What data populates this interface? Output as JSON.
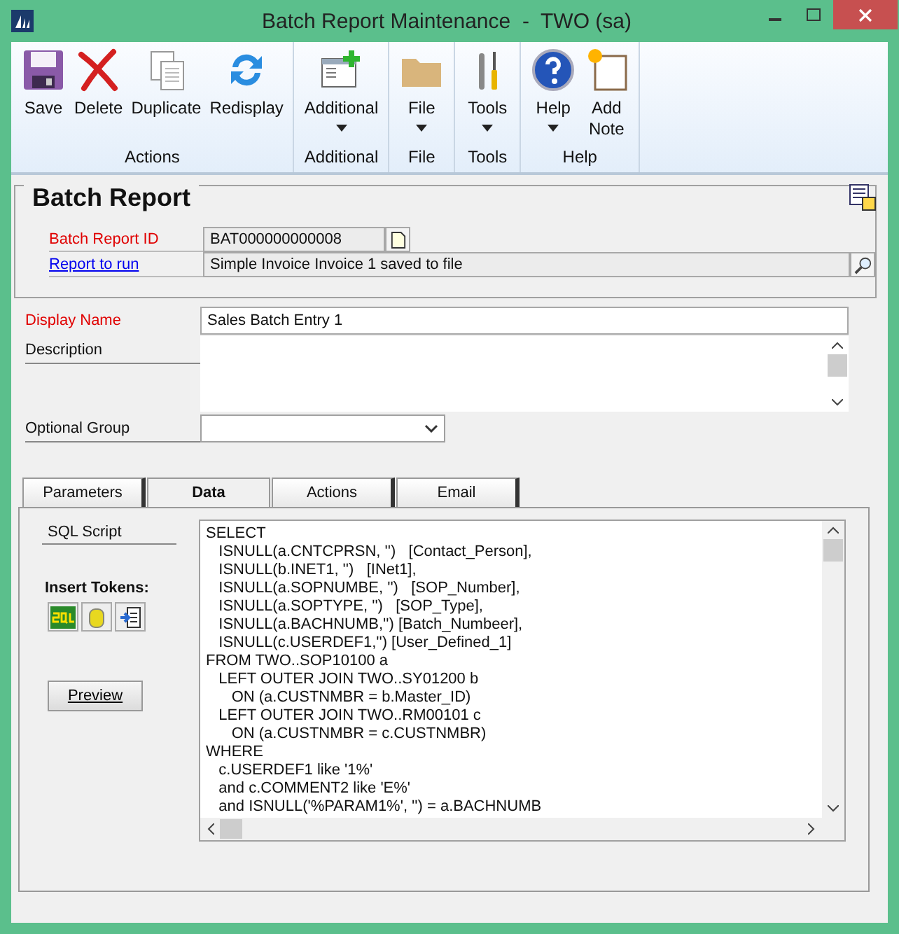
{
  "window": {
    "title": "Batch Report Maintenance  -  TWO (sa)"
  },
  "ribbon": {
    "groups": [
      {
        "label": "Actions",
        "buttons": [
          {
            "label": "Save",
            "dropdown": false
          },
          {
            "label": "Delete",
            "dropdown": false
          },
          {
            "label": "Duplicate",
            "dropdown": false
          },
          {
            "label": "Redisplay",
            "dropdown": false
          }
        ]
      },
      {
        "label": "Additional",
        "buttons": [
          {
            "label": "Additional",
            "dropdown": true
          }
        ]
      },
      {
        "label": "File",
        "buttons": [
          {
            "label": "File",
            "dropdown": true
          }
        ]
      },
      {
        "label": "Tools",
        "buttons": [
          {
            "label": "Tools",
            "dropdown": true
          }
        ]
      },
      {
        "label": "Help",
        "buttons": [
          {
            "label": "Help",
            "dropdown": true
          },
          {
            "label": "Add Note",
            "dropdown": false
          }
        ]
      }
    ]
  },
  "batch_report": {
    "title": "Batch Report",
    "id_label": "Batch Report ID",
    "id_value": "BAT000000000008",
    "report_label": "Report to run",
    "report_value": "Simple Invoice Invoice 1 saved to file"
  },
  "form": {
    "display_name_label": "Display Name",
    "display_name": "Sales Batch Entry 1",
    "description_label": "Description",
    "optional_group_label": "Optional Group"
  },
  "tabs": [
    {
      "label": "Parameters",
      "selected": false
    },
    {
      "label": "Data",
      "selected": true
    },
    {
      "label": "Actions",
      "selected": false
    },
    {
      "label": "Email",
      "selected": false
    }
  ],
  "data_tab": {
    "sql_label": "SQL Script",
    "insert_tokens": "Insert Tokens:",
    "preview": "Preview",
    "sql_lines": [
      "SELECT",
      "   ISNULL(a.CNTCPRSN, '')   [Contact_Person],",
      "   ISNULL(b.INET1, '')   [INet1],",
      "   ISNULL(a.SOPNUMBE, '')   [SOP_Number],",
      "   ISNULL(a.SOPTYPE, '')   [SOP_Type],",
      "   ISNULL(a.BACHNUMB,'') [Batch_Numbeer],",
      "   ISNULL(c.USERDEF1,'') [User_Defined_1]",
      "FROM TWO..SOP10100 a",
      "   LEFT OUTER JOIN TWO..SY01200 b",
      "      ON (a.CUSTNMBR = b.Master_ID)",
      "   LEFT OUTER JOIN TWO..RM00101 c",
      "      ON (a.CUSTNMBR = c.CUSTNMBR)",
      "WHERE",
      "   c.USERDEF1 like '1%'",
      "   and c.COMMENT2 like 'E%'",
      "   and ISNULL('%PARAM1%', '') = a.BACHNUMB"
    ]
  }
}
